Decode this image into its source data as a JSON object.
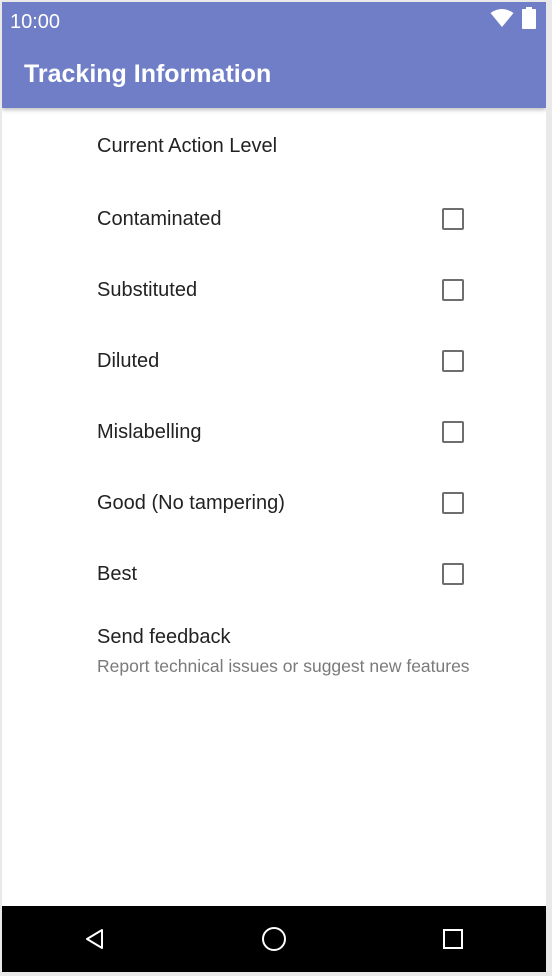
{
  "status_bar": {
    "time": "10:00",
    "icons": [
      "wifi-icon",
      "battery-icon"
    ]
  },
  "app_bar": {
    "title": "Tracking Information",
    "color": "#6f7ec6"
  },
  "preferences": {
    "header": "Current Action Level",
    "options": [
      {
        "label": "Contaminated",
        "checked": false
      },
      {
        "label": "Substituted",
        "checked": false
      },
      {
        "label": "Diluted",
        "checked": false
      },
      {
        "label": "Mislabelling",
        "checked": false
      },
      {
        "label": "Good (No tampering)",
        "checked": false
      },
      {
        "label": "Best",
        "checked": false
      }
    ],
    "feedback": {
      "title": "Send feedback",
      "summary": "Report technical issues or suggest new features"
    }
  },
  "nav_bar": {
    "buttons": [
      "back-icon",
      "home-icon",
      "recents-icon"
    ]
  }
}
